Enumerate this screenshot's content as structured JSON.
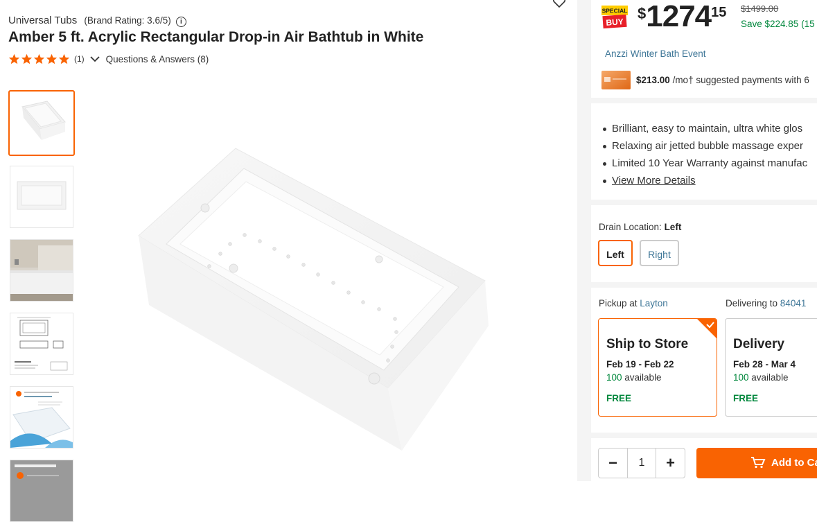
{
  "product": {
    "brand": "Universal Tubs",
    "brand_rating": "(Brand Rating: 3.6/5)",
    "title": "Amber 5 ft. Acrylic Rectangular Drop-in Air Bathtub in White",
    "stars": 5,
    "review_count": "(1)",
    "qa_label": "Questions & Answers (8)"
  },
  "pricing": {
    "badge_top": "SPECIAL",
    "badge_bottom": "BUY",
    "currency": "$",
    "dollars": "1274",
    "cents": "15",
    "was_price": "$1499.00",
    "savings": "Save $224.85 (15",
    "event_link": "Anzzi Winter Bath Event",
    "payment_amount": "$213.00",
    "payment_text": " /mo† suggested payments with 6"
  },
  "highlights": [
    "Brilliant, easy to maintain, ultra white glos",
    "Relaxing air jetted bubble massage exper",
    "Limited 10 Year Warranty against manufac"
  ],
  "view_more": "View More Details",
  "drain": {
    "label": "Drain Location: ",
    "selected": "Left",
    "options": [
      "Left",
      "Right"
    ]
  },
  "fulfillment": {
    "pickup_label": "Pickup at ",
    "pickup_store": "Layton",
    "delivering_label": "Delivering to ",
    "delivering_zip": "84041",
    "ship": {
      "title": "Ship to Store",
      "dates": "Feb 19 - Feb 22",
      "available_num": "100",
      "available_text": " available",
      "cost": "FREE"
    },
    "delivery": {
      "title": "Delivery",
      "dates": "Feb 28 - Mar 4",
      "available_num": "100",
      "available_text": " available",
      "cost": "FREE"
    }
  },
  "cart": {
    "minus": "−",
    "quantity": "1",
    "plus": "+",
    "add_label": "Add to Ca"
  },
  "colors": {
    "accent": "#f96302",
    "link": "#3e7697",
    "success": "#00873c"
  },
  "icons": [
    "heart-icon",
    "info-icon",
    "star-icon",
    "chevron-down-icon",
    "checkmark-icon",
    "cart-icon"
  ]
}
